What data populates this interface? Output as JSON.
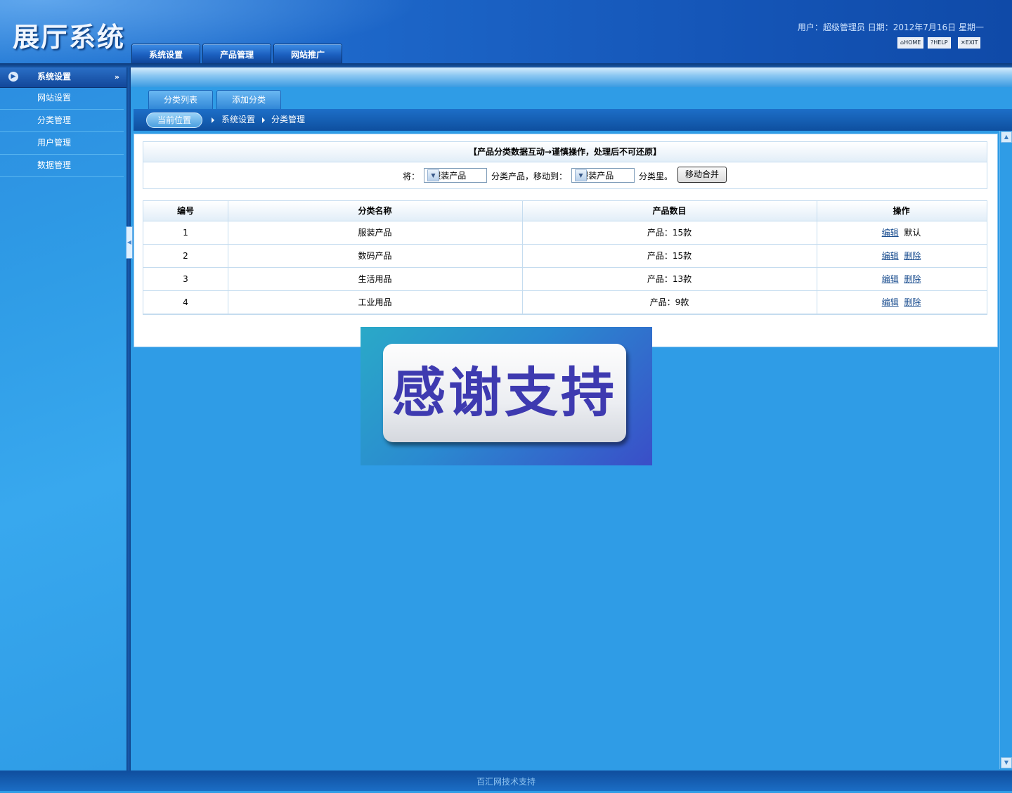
{
  "app": {
    "logo": "展厅系统"
  },
  "topnav": [
    "系统设置",
    "产品管理",
    "网站推广"
  ],
  "userinfo": "用户：超级管理员  日期：2012年7月16日  星期一",
  "header_buttons": {
    "home": "HOME",
    "help": "HELP",
    "exit": "EXIT"
  },
  "sidebar": {
    "title": "系统设置",
    "items": [
      {
        "label": "网站设置"
      },
      {
        "label": "分类管理"
      },
      {
        "label": "用户管理"
      },
      {
        "label": "数据管理"
      }
    ]
  },
  "tabs": [
    "分类列表",
    "添加分类"
  ],
  "breadcrumb": {
    "current": "当前位置",
    "items": [
      "系统设置",
      "分类管理"
    ]
  },
  "merge": {
    "title": "【产品分类数据互动→谨慎操作，处理后不可还原】",
    "label_from": "将：",
    "from_value": "├服装产品",
    "label_mid": "分类产品，移动到：",
    "to_value": "├服装产品",
    "label_end": "分类里。",
    "button": "移动合并"
  },
  "table": {
    "headers": [
      "编号",
      "分类名称",
      "产品数目",
      "操作"
    ],
    "rows": [
      {
        "id": "1",
        "name": "服装产品",
        "count": "产品：15款",
        "edit": "编辑",
        "action2": "默认"
      },
      {
        "id": "2",
        "name": "数码产品",
        "count": "产品：15款",
        "edit": "编辑",
        "action2": "删除"
      },
      {
        "id": "3",
        "name": "生活用品",
        "count": "产品：13款",
        "edit": "编辑",
        "action2": "删除"
      },
      {
        "id": "4",
        "name": "工业用品",
        "count": "产品：9款",
        "edit": "编辑",
        "action2": "删除"
      }
    ]
  },
  "promo": {
    "text": "感谢支持"
  },
  "footer": "百汇网技术支持",
  "colors": {
    "accent": "#2f9ce6",
    "header": "#1556b8",
    "link": "#1a4d8f"
  },
  "icons": [
    "home-icon",
    "help-icon",
    "exit-icon",
    "collapse-arrow-icon",
    "chevron-down-icon",
    "breadcrumb-arrow-icon",
    "dropdown-arrow-icon"
  ]
}
